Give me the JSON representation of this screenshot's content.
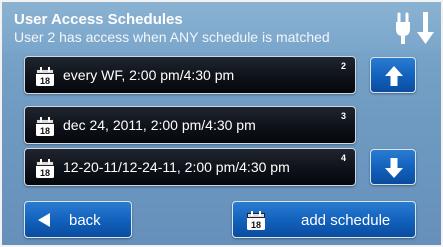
{
  "header": {
    "title": "User Access Schedules",
    "subtitle": "User 2 has access when ANY schedule is matched"
  },
  "calendar_icon_day": "18",
  "schedules": [
    {
      "label": "every WF, 2:00 pm/4:30 pm",
      "number": "2"
    },
    {
      "label": "dec 24, 2011, 2:00 pm/4:30 pm",
      "number": "3"
    },
    {
      "label": "12-20-11/12-24-11, 2:00 pm/4:30 pm",
      "number": "4"
    }
  ],
  "footer": {
    "back_label": "back",
    "add_label": "add schedule"
  },
  "icons": {
    "header": "plug-icon",
    "schedule": "calendar-icon",
    "scroll_up": "arrow-up-icon",
    "scroll_down": "arrow-down-icon",
    "back": "triangle-left-icon"
  },
  "colors": {
    "background": "#6f9bc2",
    "row": "#0e1219",
    "button": "#1160bb",
    "text": "#ffffff"
  }
}
